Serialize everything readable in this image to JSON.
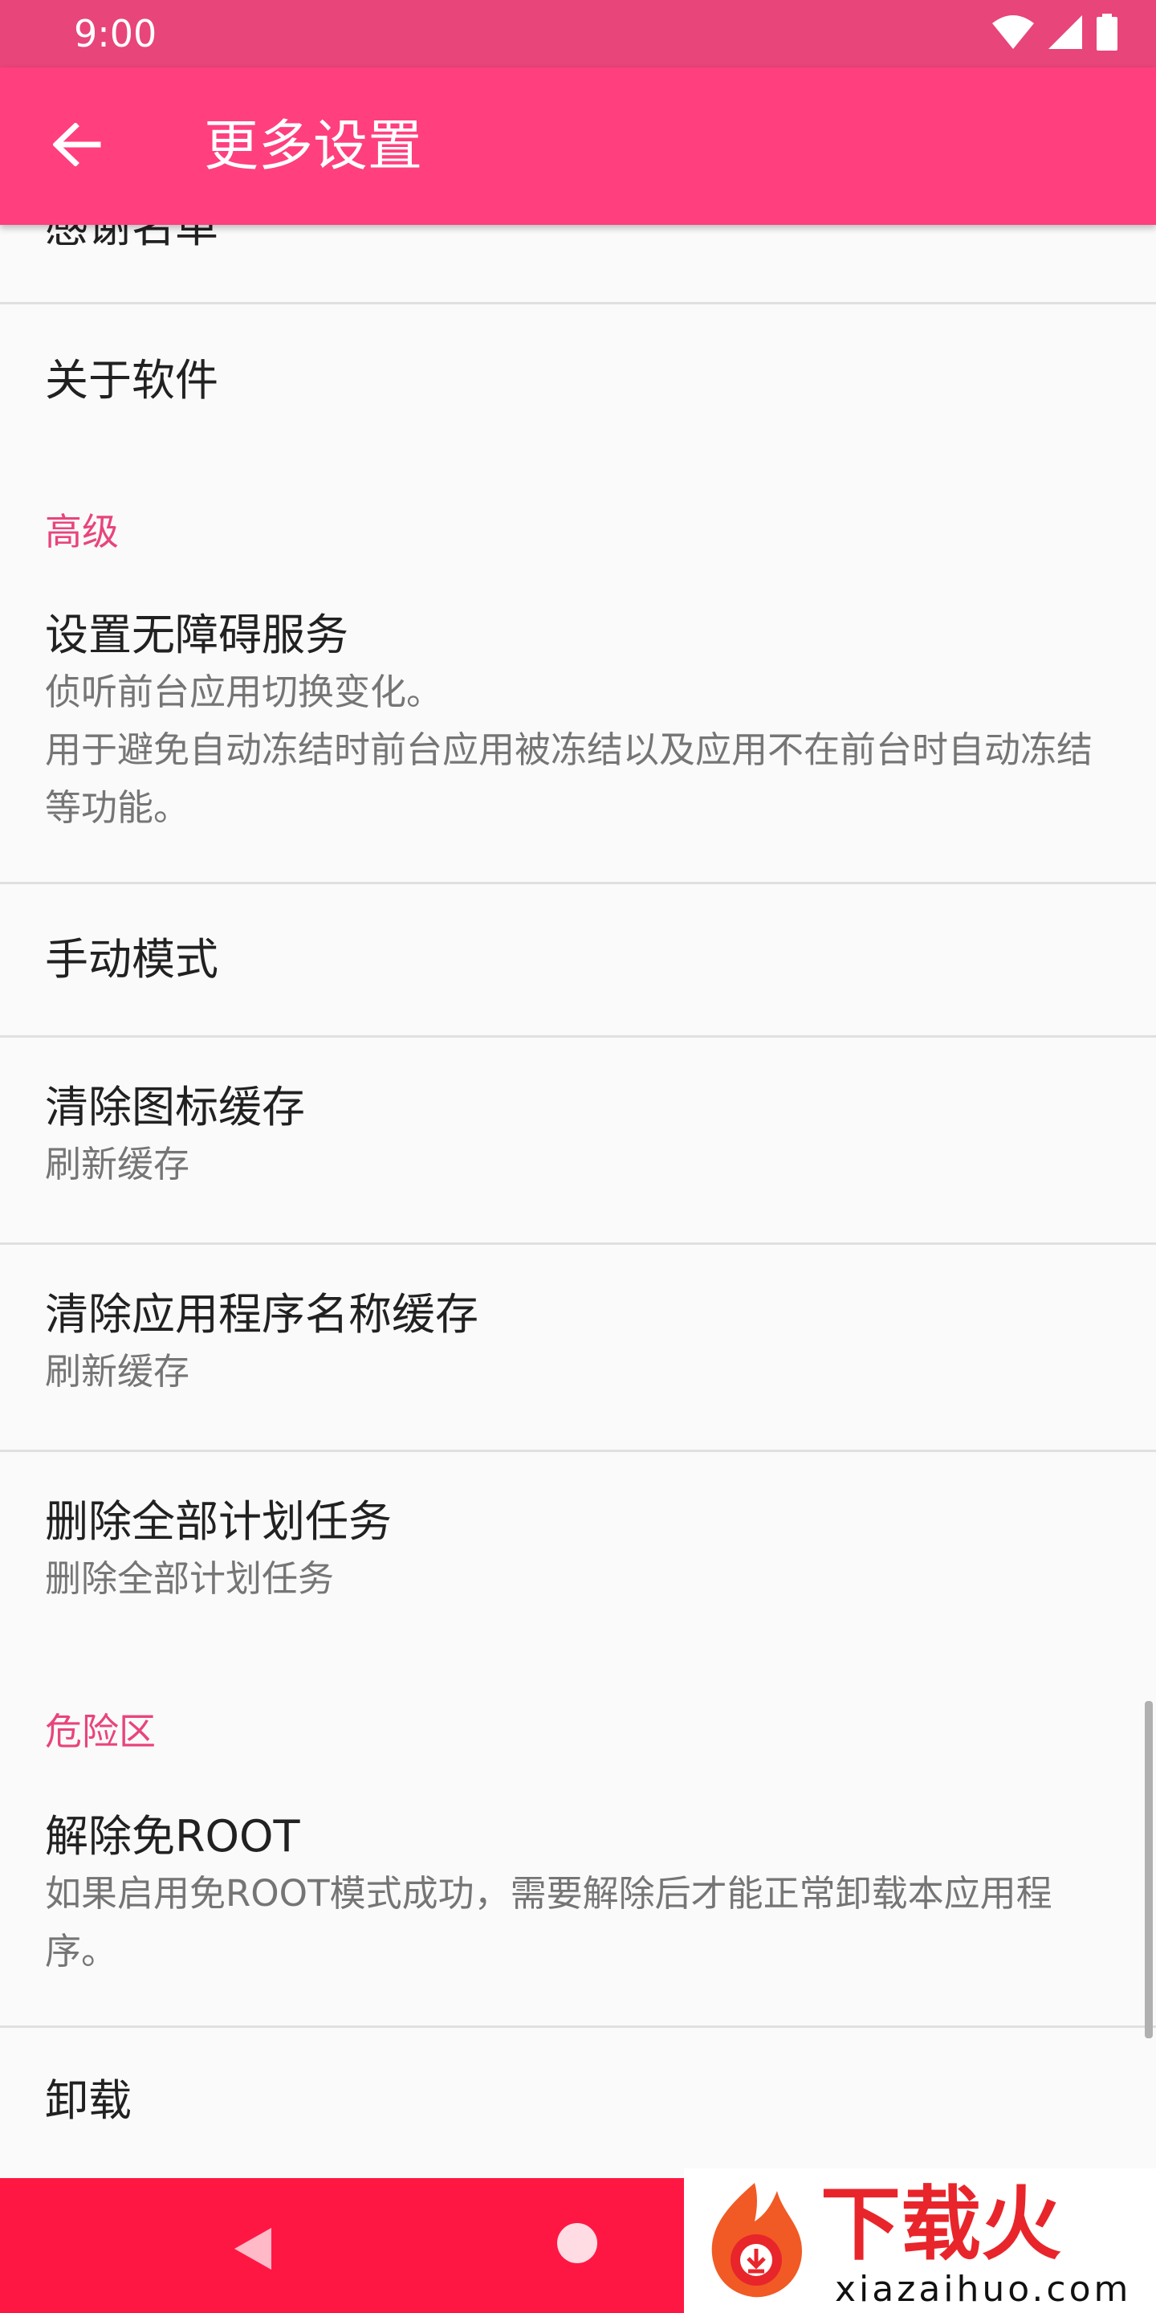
{
  "status_bar": {
    "time": "9:00"
  },
  "app_bar": {
    "title": "更多设置"
  },
  "items": [
    {
      "title": "感谢名单"
    },
    {
      "title": "关于软件"
    },
    {
      "title": "设置无障碍服务",
      "summary": "侦听前台应用切换变化。\n用于避免自动冻结时前台应用被冻结以及应用不在前台时自动冻结等功能。"
    },
    {
      "title": "手动模式"
    },
    {
      "title": "清除图标缓存",
      "summary": "刷新缓存"
    },
    {
      "title": "清除应用程序名称缓存",
      "summary": "刷新缓存"
    },
    {
      "title": "删除全部计划任务",
      "summary": "删除全部计划任务"
    },
    {
      "title": "解除免ROOT",
      "summary": "如果启用免ROOT模式成功，需要解除后才能正常卸载本应用程序。"
    },
    {
      "title": "卸载"
    }
  ],
  "categories": {
    "advanced": "高级",
    "danger_zone": "危险区"
  },
  "watermark": {
    "text": "下载火",
    "url": "xiazaihuo.com"
  },
  "colors": {
    "primary": "#ff3f7e",
    "status_bar": "#e8457a",
    "accent": "#e8457a",
    "nav_bar": "#ff1744"
  },
  "icons": {
    "back": "arrow-left-icon",
    "wifi": "wifi-icon",
    "signal": "signal-icon",
    "battery": "battery-icon",
    "nav_back": "triangle-back-icon",
    "nav_home": "circle-home-icon"
  }
}
